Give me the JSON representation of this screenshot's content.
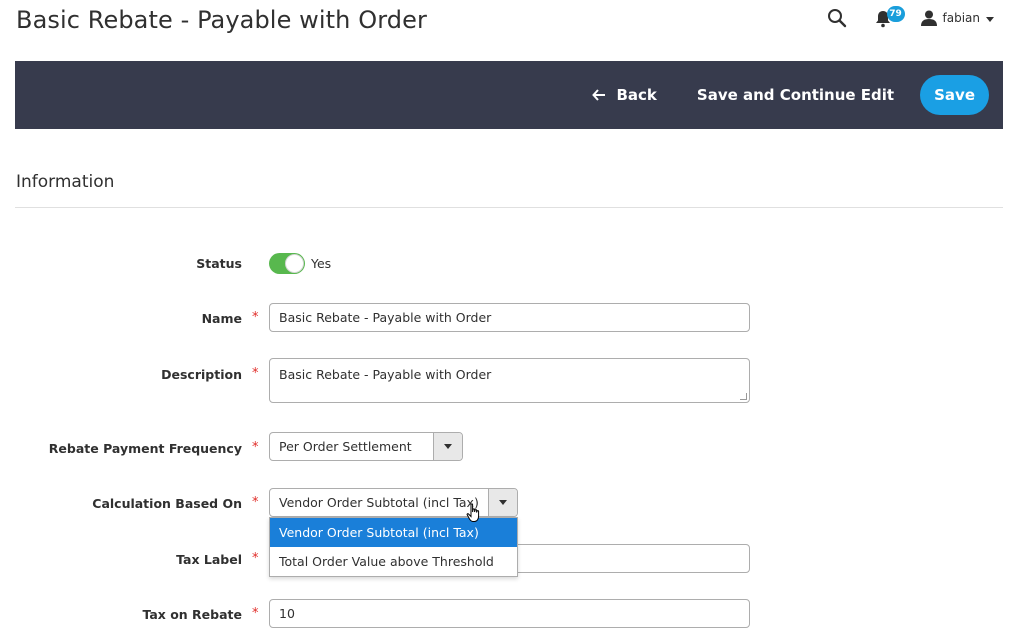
{
  "header": {
    "title": "Basic Rebate - Payable with Order",
    "notifications_count": "79",
    "user_name": "fabian"
  },
  "action_bar": {
    "back_label": "Back",
    "save_continue_label": "Save and Continue Edit",
    "save_label": "Save"
  },
  "section": {
    "title": "Information"
  },
  "form": {
    "status": {
      "label": "Status",
      "value": "Yes",
      "enabled": true
    },
    "name": {
      "label": "Name",
      "value": "Basic Rebate - Payable with Order"
    },
    "description": {
      "label": "Description",
      "value": "Basic Rebate - Payable with Order"
    },
    "rebate_payment_frequency": {
      "label": "Rebate Payment Frequency",
      "value": "Per Order Settlement"
    },
    "calculation_based_on": {
      "label": "Calculation Based On",
      "value": "Vendor Order Subtotal (incl Tax)",
      "options": [
        "Vendor Order Subtotal (incl Tax)",
        "Total Order Value above Threshold"
      ]
    },
    "tax_label": {
      "label": "Tax Label",
      "value": ""
    },
    "tax_on_rebate": {
      "label": "Tax on Rebate",
      "value": "10"
    },
    "required_marker": "*"
  },
  "colors": {
    "action_bar_bg": "#373b4d",
    "save_button": "#1a9fe4",
    "toggle_on": "#58b84e",
    "required": "#e02b27",
    "dropdown_selected": "#1a7fd9",
    "badge": "#1a9edb"
  }
}
